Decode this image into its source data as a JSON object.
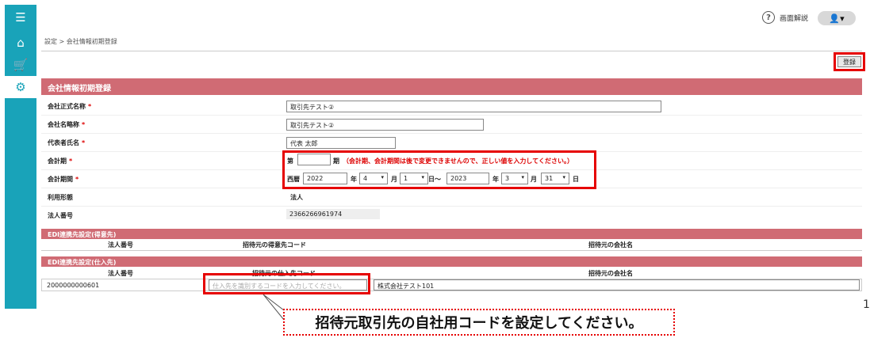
{
  "sidebar": {
    "items": [
      {
        "icon": "menu-icon",
        "glyph": "☰"
      },
      {
        "icon": "home-icon",
        "glyph": "⌂"
      },
      {
        "icon": "cart-icon",
        "glyph": "🛒"
      },
      {
        "icon": "gear-icon",
        "glyph": "⚙"
      }
    ]
  },
  "header": {
    "help_label": "画面解説",
    "help_glyph": "?",
    "user_glyph": "👤▾"
  },
  "breadcrumb": "設定 > 会社情報初期登録",
  "toolbar": {
    "register_label": "登録"
  },
  "form": {
    "title": "会社情報初期登録",
    "required_mark": "*",
    "official_name_label": "会社正式名称",
    "official_name_value": "取引先テスト②",
    "short_name_label": "会社名略称",
    "short_name_value": "取引先テスト②",
    "representative_label": "代表者氏名",
    "representative_value": "代表 太郎",
    "fiscal_term_label": "会計期",
    "fiscal_term_prefix": "第",
    "fiscal_term_value": "",
    "fiscal_term_suffix": "期",
    "fiscal_term_note": "（会計期、会計期間は後で変更できませんので、正しい値を入力してください。）",
    "fiscal_period_label": "会計期間",
    "era_label": "西暦",
    "start_year": "2022",
    "year_unit": "年",
    "start_month": "4",
    "month_unit": "月",
    "start_day": "1",
    "day_unit_tilde": "日〜",
    "end_year": "2023",
    "end_month": "3",
    "end_day": "31",
    "day_unit": "日",
    "usage_label": "利用形態",
    "usage_value": "法人",
    "corp_number_label": "法人番号",
    "corp_number_value": "2366266961974"
  },
  "edi_customer": {
    "title": "EDI連携先設定(得意先)",
    "col_corp_number": "法人番号",
    "col_code": "招待元の得意先コード",
    "col_company": "招待元の会社名"
  },
  "edi_supplier": {
    "title": "EDI連携先設定(仕入先)",
    "col_corp_number": "法人番号",
    "col_code": "招待元の仕入先コード",
    "col_company": "招待元の会社名",
    "rows": [
      {
        "corp_number": "2000000000601",
        "code_placeholder": "仕入先を識別するコードを入力してください。",
        "company_name": "株式会社テスト101"
      }
    ]
  },
  "callout_text": "招待元取引先の自社用コードを設定してください。",
  "page_number": "1",
  "colors": {
    "sidebar": "#19a3b9",
    "section_header": "#d06b74",
    "highlight": "#e60000"
  }
}
